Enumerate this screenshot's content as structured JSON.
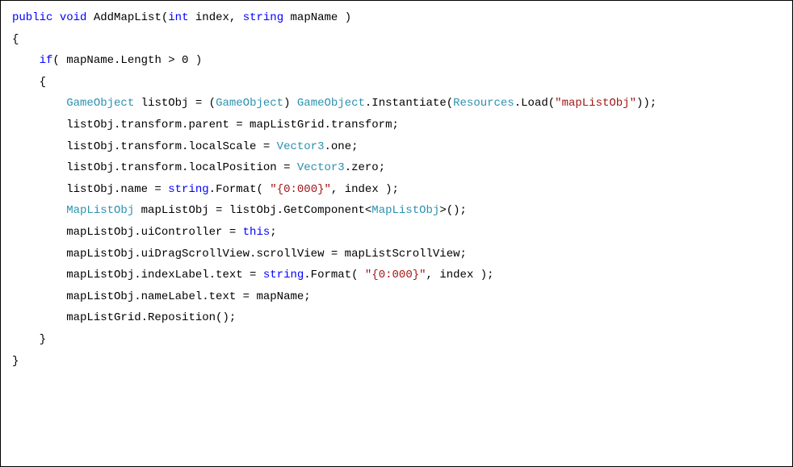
{
  "code": {
    "lines": [
      {
        "indent": 0,
        "tokens": [
          {
            "cls": "kw",
            "t": "public"
          },
          {
            "cls": "txt",
            "t": " "
          },
          {
            "cls": "kw",
            "t": "void"
          },
          {
            "cls": "txt",
            "t": " AddMapList("
          },
          {
            "cls": "kw",
            "t": "int"
          },
          {
            "cls": "txt",
            "t": " index, "
          },
          {
            "cls": "kw",
            "t": "string"
          },
          {
            "cls": "txt",
            "t": " mapName )"
          }
        ]
      },
      {
        "indent": 0,
        "tokens": [
          {
            "cls": "txt",
            "t": "{"
          }
        ]
      },
      {
        "indent": 1,
        "tokens": [
          {
            "cls": "kw",
            "t": "if"
          },
          {
            "cls": "txt",
            "t": "( mapName.Length > 0 )"
          }
        ]
      },
      {
        "indent": 1,
        "tokens": [
          {
            "cls": "txt",
            "t": "{"
          }
        ]
      },
      {
        "indent": 2,
        "tokens": [
          {
            "cls": "type",
            "t": "GameObject"
          },
          {
            "cls": "txt",
            "t": " listObj = ("
          },
          {
            "cls": "type",
            "t": "GameObject"
          },
          {
            "cls": "txt",
            "t": ") "
          },
          {
            "cls": "type",
            "t": "GameObject"
          },
          {
            "cls": "txt",
            "t": ".Instantiate("
          },
          {
            "cls": "type",
            "t": "Resources"
          },
          {
            "cls": "txt",
            "t": ".Load("
          },
          {
            "cls": "str",
            "t": "\"mapListObj\""
          },
          {
            "cls": "txt",
            "t": "));"
          }
        ]
      },
      {
        "indent": 2,
        "tokens": [
          {
            "cls": "txt",
            "t": "listObj.transform.parent = mapListGrid.transform;"
          }
        ]
      },
      {
        "indent": 2,
        "tokens": [
          {
            "cls": "txt",
            "t": "listObj.transform.localScale = "
          },
          {
            "cls": "type",
            "t": "Vector3"
          },
          {
            "cls": "txt",
            "t": ".one;"
          }
        ]
      },
      {
        "indent": 2,
        "tokens": [
          {
            "cls": "txt",
            "t": "listObj.transform.localPosition = "
          },
          {
            "cls": "type",
            "t": "Vector3"
          },
          {
            "cls": "txt",
            "t": ".zero;"
          }
        ]
      },
      {
        "indent": 2,
        "tokens": [
          {
            "cls": "txt",
            "t": "listObj.name = "
          },
          {
            "cls": "kw",
            "t": "string"
          },
          {
            "cls": "txt",
            "t": ".Format( "
          },
          {
            "cls": "str",
            "t": "\"{0:000}\""
          },
          {
            "cls": "txt",
            "t": ", index );"
          }
        ]
      },
      {
        "indent": 0,
        "tokens": [
          {
            "cls": "txt",
            "t": ""
          }
        ]
      },
      {
        "indent": 2,
        "tokens": [
          {
            "cls": "type",
            "t": "MapListObj"
          },
          {
            "cls": "txt",
            "t": " mapListObj = listObj.GetComponent<"
          },
          {
            "cls": "type",
            "t": "MapListObj"
          },
          {
            "cls": "txt",
            "t": ">();"
          }
        ]
      },
      {
        "indent": 2,
        "tokens": [
          {
            "cls": "txt",
            "t": "mapListObj.uiController = "
          },
          {
            "cls": "this",
            "t": "this"
          },
          {
            "cls": "txt",
            "t": ";"
          }
        ]
      },
      {
        "indent": 2,
        "tokens": [
          {
            "cls": "txt",
            "t": "mapListObj.uiDragScrollView.scrollView = mapListScrollView;"
          }
        ]
      },
      {
        "indent": 0,
        "tokens": [
          {
            "cls": "txt",
            "t": ""
          }
        ]
      },
      {
        "indent": 2,
        "tokens": [
          {
            "cls": "txt",
            "t": "mapListObj.indexLabel.text = "
          },
          {
            "cls": "kw",
            "t": "string"
          },
          {
            "cls": "txt",
            "t": ".Format( "
          },
          {
            "cls": "str",
            "t": "\"{0:000}\""
          },
          {
            "cls": "txt",
            "t": ", index );"
          }
        ]
      },
      {
        "indent": 2,
        "tokens": [
          {
            "cls": "txt",
            "t": "mapListObj.nameLabel.text = mapName;"
          }
        ]
      },
      {
        "indent": 0,
        "tokens": [
          {
            "cls": "txt",
            "t": ""
          }
        ]
      },
      {
        "indent": 2,
        "tokens": [
          {
            "cls": "txt",
            "t": "mapListGrid.Reposition();"
          }
        ]
      },
      {
        "indent": 1,
        "tokens": [
          {
            "cls": "txt",
            "t": "}"
          }
        ]
      },
      {
        "indent": 0,
        "tokens": [
          {
            "cls": "txt",
            "t": "}"
          }
        ]
      }
    ]
  }
}
